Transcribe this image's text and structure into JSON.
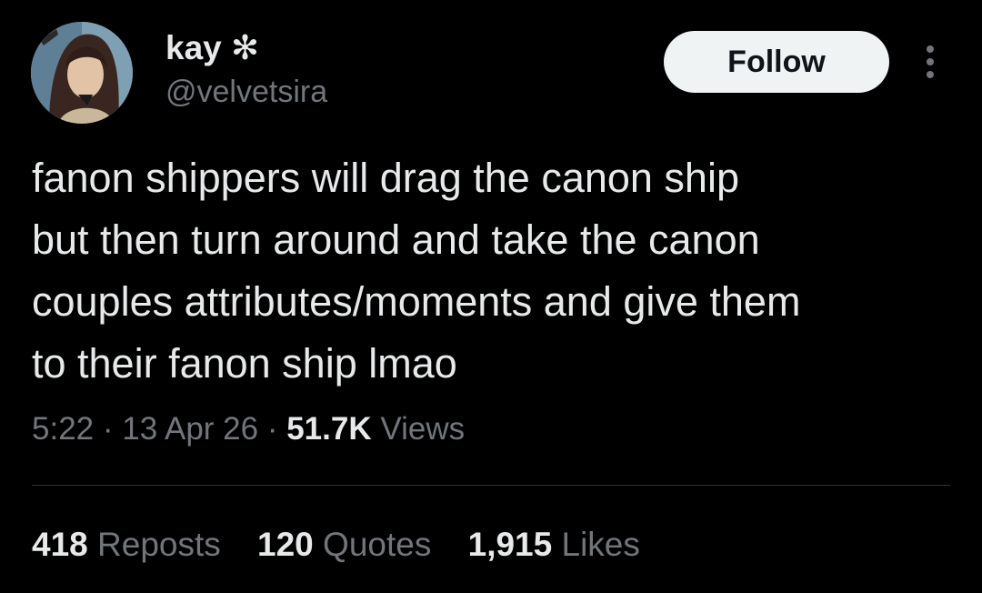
{
  "author": {
    "display_name": "kay ✻",
    "handle": "@velvetsira"
  },
  "actions": {
    "follow_label": "Follow",
    "more_icon": "more-vertical-icon"
  },
  "tweet": {
    "text": "fanon shippers will drag the canon ship\nbut then turn around and take the canon\ncouples attributes/moments and give them\nto their fanon ship lmao",
    "time": "5:22",
    "separator": "·",
    "date": "13 Apr 26",
    "views_count": "51.7K",
    "views_label": "Views"
  },
  "stats": {
    "reposts_count": "418",
    "reposts_label": "Reposts",
    "quotes_count": "120",
    "quotes_label": "Quotes",
    "likes_count": "1,915",
    "likes_label": "Likes"
  },
  "colors": {
    "background": "#000000",
    "primary_text": "#e7e9ea",
    "secondary_text": "#71767b",
    "follow_button_bg": "#eff3f4",
    "divider": "#2f3336"
  }
}
